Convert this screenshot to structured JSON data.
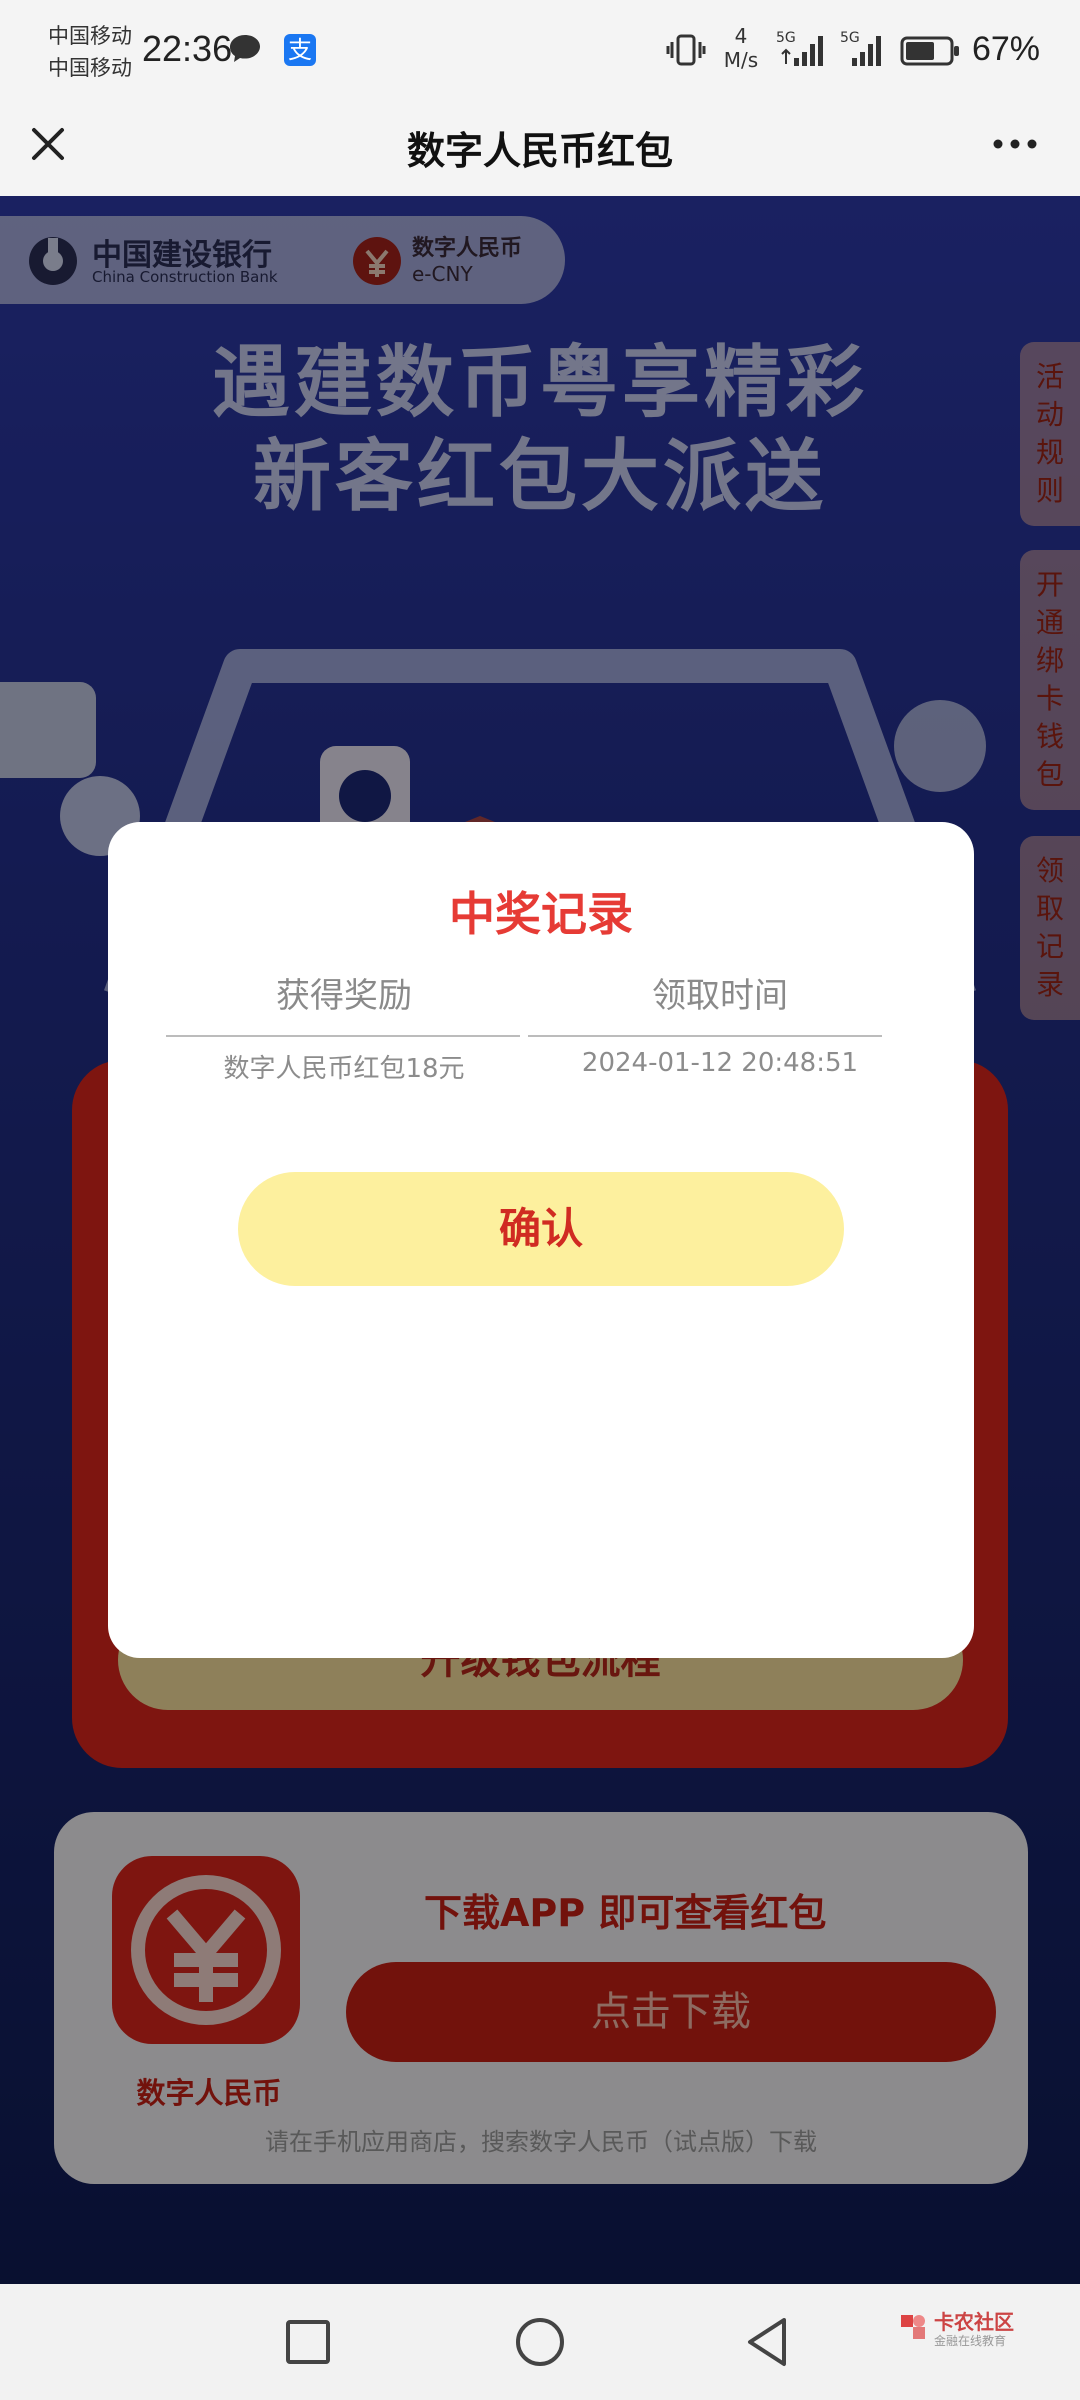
{
  "status_bar": {
    "carrier_1": "中国移动",
    "carrier_2": "中国移动",
    "time": "22:36",
    "net_speed_top": "4",
    "net_speed_unit": "M/s",
    "signal_1_label": "5G",
    "signal_2_label": "5G",
    "battery": "67%",
    "battery_level": 0.67
  },
  "title_bar": {
    "title": "数字人民币红包",
    "close_icon": "close-icon",
    "more_icon": "more-icon"
  },
  "banner": {
    "bank_cn": "中国建设银行",
    "bank_en": "China Construction Bank",
    "ecny_cn": "数字人民币",
    "ecny_en": "e-CNY"
  },
  "hero": {
    "line1": "遇建数币粤享精彩",
    "line2": "新客红包大派送"
  },
  "side_tabs": [
    {
      "label": "活动规则"
    },
    {
      "label": "开通绑卡钱包"
    },
    {
      "label": "领取记录"
    }
  ],
  "red_card": {
    "upgrade_label": "升级钱包流程"
  },
  "download": {
    "app_name": "数字人民币",
    "title": "下载APP 即可查看红包",
    "button": "点击下载",
    "hint": "请在手机应用商店，搜索数字人民币（试点版）下载"
  },
  "modal": {
    "title": "中奖记录",
    "col_reward": "获得奖励",
    "col_time": "领取时间",
    "rows": [
      {
        "reward": "数字人民币红包18元",
        "time": "2024-01-12 20:48:51"
      }
    ],
    "confirm": "确认"
  },
  "nav_bar": {
    "recents_icon": "square-icon",
    "home_icon": "circle-icon",
    "back_icon": "triangle-back-icon",
    "watermark_cn": "卡农社区",
    "watermark_sub": "金融在线教育"
  },
  "colors": {
    "accent_red": "#e63b35",
    "confirm_yellow": "#fdf09e",
    "page_blue": "#2d39a8"
  }
}
